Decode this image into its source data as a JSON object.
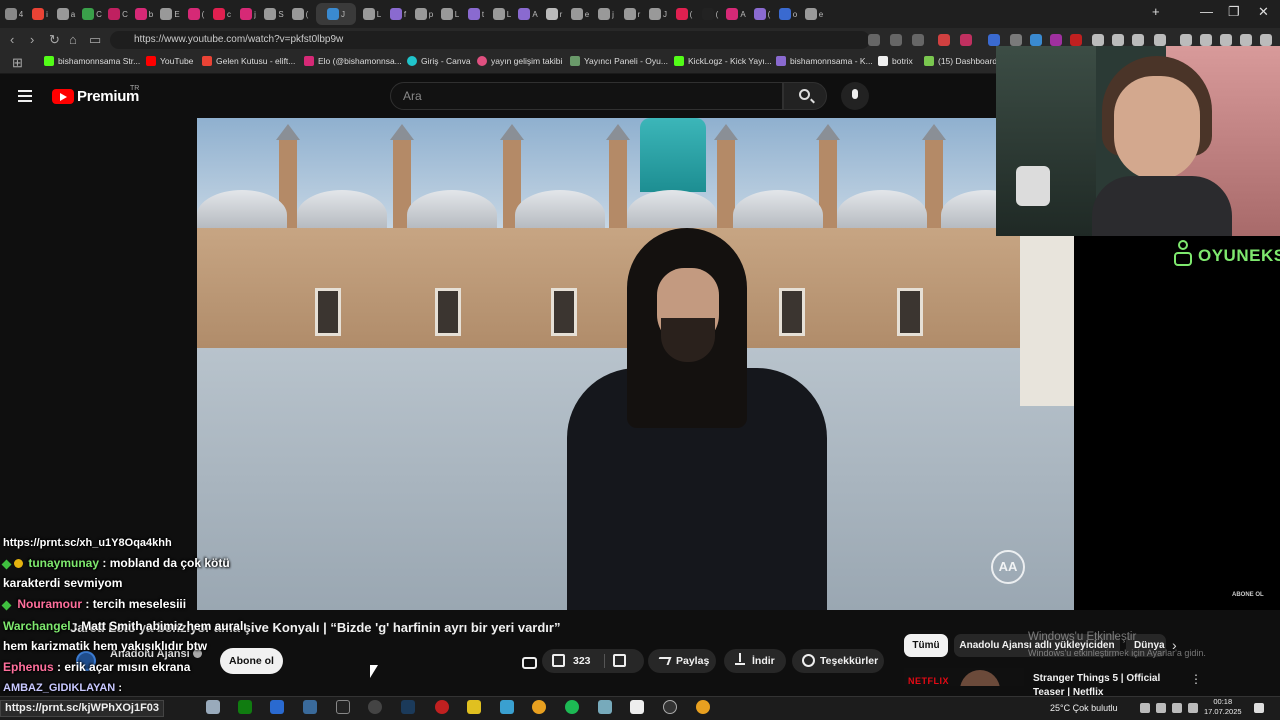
{
  "browser": {
    "url": "https://www.youtube.com/watch?v=pkfst0lbp9w",
    "tab_letters": [
      "4",
      "i",
      "a",
      "C",
      "C",
      "b",
      "E",
      "(",
      "c",
      "j",
      "S",
      "(",
      "J",
      "L",
      "f",
      "p",
      "L",
      "t",
      "L",
      "A",
      "r",
      "e",
      "j",
      "r",
      "J",
      "(",
      "(",
      "A",
      "(",
      "o",
      "e"
    ],
    "bookmarks": [
      "bishamonnsama Str...",
      "YouTube",
      "Gelen Kutusu - elift...",
      "Elo (@bishamonnsa...",
      "Giriş - Canva",
      "yayın gelişim takibi",
      "Yayıncı Paneli - Oyu...",
      "KickLogz - Kick Yayı...",
      "bishamonnsama - K...",
      "botrix",
      "(15) Dashboard..."
    ],
    "colors": {
      "bar": "#282828",
      "tabstrip": "#1f1f1f"
    }
  },
  "youtube": {
    "brand": "Premium",
    "region": "TR",
    "search_placeholder": "Ara",
    "video_title": "Jared Leto'ya benziyor ama şive Konyalı | “Bizde 'g' harfinin ayrı bir yeri vardır”",
    "channel_name": "Anadolu Ajansı",
    "subscribe_label": "Abone ol",
    "like_count": "323",
    "share_label": "Paylaş",
    "download_label": "İndir",
    "thanks_label": "Teşekkürler",
    "chips": [
      "Tümü",
      "Anadolu Ajansı adlı yükleyiciden",
      "Dünya"
    ],
    "rec_netflix": "NETFLIX",
    "rec_title": "Stranger Things 5 | Official Teaser | Netflix",
    "watermark": "AA",
    "colors": {
      "accent": "#ff0000",
      "bg": "#0f0f0f"
    }
  },
  "overlay": {
    "sponsor": "OYUNEKS",
    "abone_ol_small": "ABONE OL",
    "win_activate_title": "Windows'u Etkinleştir",
    "win_activate_sub": "Windows'u etkinleştirmek için Ayarlar'a gidin."
  },
  "chat": [
    {
      "user": "",
      "text": "https://prnt.sc/xh_u1Y8Oqa4khh",
      "color": "#ffffff"
    },
    {
      "user": "tunaymunay",
      "text": ": mobland da çok kötü",
      "color": "#7ee86e"
    },
    {
      "user": "",
      "text": "karakterdi sevmiyom",
      "color": "#ffffff"
    },
    {
      "user": "Nouramour",
      "text": ": tercih meselesiii",
      "color": "#ff6f9c"
    },
    {
      "user": "Warchangel",
      "text": ": Matt Smith abimiz hem auralı",
      "color": "#7ee86e"
    },
    {
      "user": "",
      "text": "hem karizmatik hem yakışıklıdır btw",
      "color": "#ffffff"
    },
    {
      "user": "Ephenus",
      "text": ": erik açar mısın ekrana",
      "color": "#ff6f9c"
    },
    {
      "user": "AMBAZ_GIDIKLAYAN",
      "text": ":",
      "color": "#c8c8ff"
    }
  ],
  "status_link": "https://prnt.sc/kjWPhXOj1F03",
  "taskbar": {
    "weather": "25°C  Çok bulutlu",
    "time": "00:18",
    "date": "17.07.2025"
  }
}
